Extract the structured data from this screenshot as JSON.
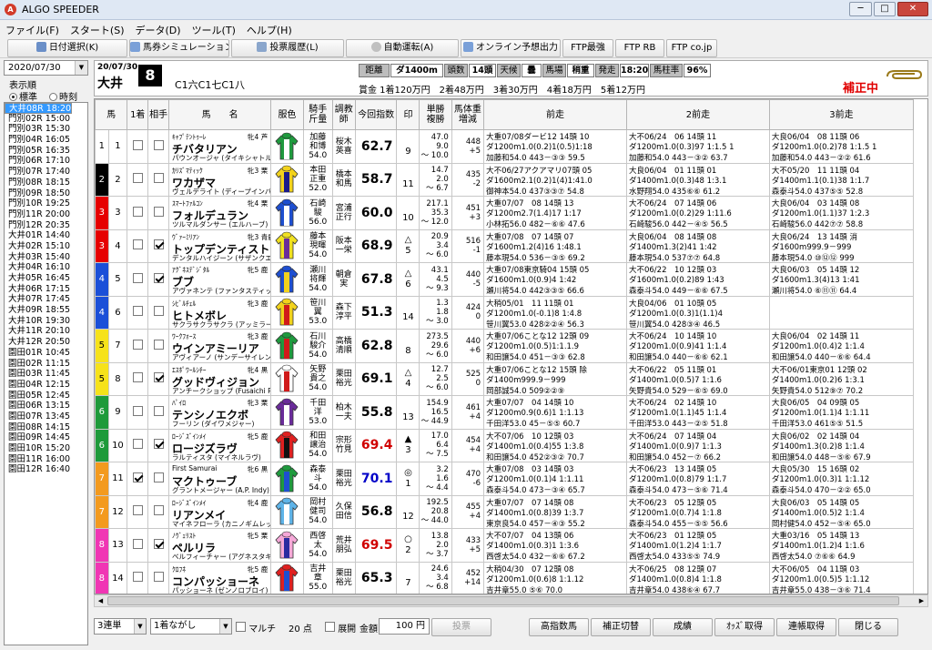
{
  "app": {
    "title": "ALGO SPEEDER",
    "min": "─",
    "max": "□",
    "close": "✕",
    "logo": "A"
  },
  "menu": [
    "ファイル(F)",
    "スタート(S)",
    "データ(D)",
    "ツール(T)",
    "ヘルプ(H)"
  ],
  "toolbar": [
    "日付選択(K)",
    "馬券シミュレーション(B)",
    "投票履歴(L)",
    "自動運転(A)",
    "オンライン予想出力",
    "FTP最強",
    "FTP RB",
    "FTP co.jp"
  ],
  "left": {
    "date": "2020/07/30",
    "group_label": "表示順",
    "radio_std": "標準",
    "radio_time": "時刻"
  },
  "races": [
    "門別01R 14:30",
    "門別02R 15:00",
    "門別03R 15:30",
    "門別04R 16:05",
    "門別05R 16:35",
    "門別06R 17:10",
    "門別07R 17:40",
    "門別08R 18:15",
    "門別09R 18:50",
    "門別10R 19:25",
    "門別11R 20:00",
    "門別12R 20:35",
    "大井01R 14:40",
    "大井02R 15:10",
    "大井03R 15:40",
    "大井04R 16:10",
    "大井05R 16:45",
    "大井06R 17:15",
    "大井07R 17:45",
    "大井08R 18:20",
    "大井09R 18:55",
    "大井10R 19:30",
    "大井11R 20:10",
    "大井12R 20:50",
    "園田01R 10:45",
    "園田02R 11:15",
    "園田03R 11:45",
    "園田04R 12:15",
    "園田05R 12:45",
    "園田06R 13:15",
    "園田07R 13:45",
    "園田08R 14:15",
    "園田09R 14:45",
    "園田10R 15:20",
    "園田11R 16:00",
    "園田12R 16:40"
  ],
  "selected_race": "大井08R 18:20",
  "race": {
    "date": "20/07/30",
    "place": "大井",
    "no": "8",
    "class": "C1六C1七C1八",
    "info": [
      [
        "距離",
        "g"
      ],
      [
        "ダ1400m",
        "w"
      ],
      [
        "頭数",
        "g"
      ],
      [
        "14頭",
        "w"
      ],
      [
        "天候",
        "g"
      ],
      [
        "曇",
        "w"
      ],
      [
        "馬場",
        "g"
      ],
      [
        "稍重",
        "w"
      ],
      [
        "発走",
        "g"
      ],
      [
        "18:20",
        "w"
      ],
      [
        "馬柱率",
        "g"
      ],
      [
        "96%",
        "w"
      ]
    ],
    "prize": "賞金 1着120万円　2着48万円　3着30万円　4着18万円　5着12万円",
    "hosei": "補正中"
  },
  "columns": [
    "馬",
    "1着",
    "相手",
    "馬　　名",
    "服色",
    "騎手\n斤量",
    "調教\n師",
    "今回指数",
    "印",
    "単勝\n複勝",
    "馬体重\n増減",
    "前走",
    "2前走",
    "3前走"
  ],
  "horses": [
    {
      "waku": "1",
      "wc": "#ffffff",
      "no": "1",
      "c1": false,
      "c2": false,
      "sire": "ｷｬﾌﾟﾃﾝﾄｩｰﾚ",
      "sex": "牝4 芦",
      "name": "チバタリアン",
      "dam": "パウンオージャ (タイキシャトル)",
      "jockey": "加藤\n和博\n54.0",
      "trainer": "桜木\n英喜",
      "idx": "62.7",
      "ic": "",
      "mark": "\n9",
      "odds": "47.0\n9.0\n～ 10.0",
      "wt": "448\n+5",
      "silk": [
        "#1f9a3e",
        "#ffffff"
      ],
      "p": [
        [
          "大重07/08ダービ12 14頭 10",
          "ダ1200m1.0(0.2)1(0.5)1:18",
          "加藤和54.0 443－③③ 59.5"
        ],
        [
          "大不06/24　06 14頭 11",
          "ダ1200m1.0(0.3)97 1:1.5 1",
          "加藤和54.0 443－③② 63.7"
        ],
        [
          "大良06/04　08 11頭 06",
          "ダ1200m1.0(0.2)78 1:1.5 1",
          "加藤和54.0 443－②② 61.6"
        ]
      ]
    },
    {
      "waku": "2",
      "wc": "#000000",
      "no": "2",
      "c1": false,
      "c2": false,
      "sire": "ｶﾘｽﾞﾏﾃｨｯｸ",
      "sex": "牝3 栗",
      "name": "ワカザマ",
      "dam": "ヴェルデライト (ディープインパクト)",
      "jockey": "本田\n正重\n52.0",
      "trainer": "橋本\n和馬",
      "idx": "58.7",
      "ic": "",
      "mark": "\n11",
      "odds": "14.7\n2.0\n～ 6.7",
      "wt": "435\n-2",
      "silk": [
        "#f2d21c",
        "#1a1a8a"
      ],
      "p": [
        [
          "大不06/27アクアマリ07頭 05",
          "ダ1600m2.1(0.2)1(4)1:41.0",
          "御神本54.0 437③③⑦ 54.8"
        ],
        [
          "大良06/04　01 11頭 01",
          "ダ1400m1.0(0.3)48 1:3.1",
          "水野翔54.0 435⑥⑥ 61.2"
        ],
        [
          "大不05/20　11 11頭 04",
          "ダ1400m1.1(0.1)38 1:1.7",
          "森泰斗54.0 437⑤⑤ 52.8"
        ]
      ]
    },
    {
      "waku": "3",
      "wc": "#e60000",
      "no": "3",
      "c1": false,
      "c2": false,
      "sire": "ｽﾏｰﾄﾌｧﾙｺﾝ",
      "sex": "牝4 栗",
      "name": "フォルデュラン",
      "dam": "ツルマルダンサー (エルハーブ)",
      "jockey": "石崎\n駿\n56.0",
      "trainer": "宮浦\n正行",
      "idx": "60.0",
      "ic": "",
      "mark": "\n10",
      "odds": "217.1\n35.3\n～ 12.0",
      "wt": "451\n+3",
      "silk": [
        "#1e4fd0",
        "#ffffff"
      ],
      "p": [
        [
          "大重07/07　08 14頭 13",
          "ダ1200m2.7(1.4)17 1:17",
          "小林拓56.0 482－⑥⑥ 47.6"
        ],
        [
          "大不06/24　07 14頭 06",
          "ダ1200m1.0(0.2)29 1:11.6",
          "石崎駿56.0 442－④⑤ 56.5"
        ],
        [
          "大良06/04　03 14頭 08",
          "ダ1200m1.0(1.1)37 1:2.3",
          "石崎駿56.0 442⑦⑦ 58.8"
        ]
      ]
    },
    {
      "waku": "3",
      "wc": "#e60000",
      "no": "4",
      "c1": false,
      "c2": true,
      "sire": "ｳﾞｧｰﾐﾘｱﾝ",
      "sex": "牝3 青鹿",
      "name": "トップデンティスト",
      "dam": "デンタルハイジーン (サザンクエスト)",
      "jockey": "藤本\n現暉\n54.0",
      "trainer": "阪本\n一栄",
      "idx": "68.9",
      "ic": "",
      "mark": "△\n5",
      "odds": "20.9\n3.4\n～ 6.0",
      "wt": "516\n-1",
      "silk": [
        "#f0e020",
        "#6a2b9a"
      ],
      "p": [
        [
          "大重07/08　07 14頭 07",
          "ダ1600m1.2(4)16 1:48.1",
          "藤本現54.0 536－③⑤ 69.2"
        ],
        [
          "大良06/04　08 14頭 08",
          "ダ1400m1.3(2)41 1:42",
          "藤本現54.0 537⑦⑦ 64.8"
        ],
        [
          "大良06/24　13 14頭 消",
          "ダ1600m999.9－999",
          "藤本現54.0 ⑩⑫⑫ 999"
        ]
      ]
    },
    {
      "waku": "4",
      "wc": "#1a4fd8",
      "no": "5",
      "c1": false,
      "c2": true,
      "sire": "ｱｸﾞﾈｽﾃﾞｼﾞﾀﾙ",
      "sex": "牝5 鹿",
      "name": "ブブ",
      "dam": "アヴァネンテ (ファンタスティックライト)",
      "jockey": "瀬川\n将輝\n54.0",
      "trainer": "朝倉\n実",
      "idx": "67.8",
      "ic": "",
      "mark": "△\n6",
      "odds": "43.1\n4.5\n～ 9.3",
      "wt": "440\n-5",
      "silk": [
        "#1e4fd0",
        "#f2d21c"
      ],
      "p": [
        [
          "大重07/08東京騎04 15頭 05",
          "ダ1600m1.0(0.9)4 1:42",
          "瀬川将54.0 442③③⑤ 66.6"
        ],
        [
          "大不06/22　10 12頭 03",
          "ダ1600m1.0(0.2)89 1:43",
          "森泰斗54.0 449－⑥⑥ 67.5"
        ],
        [
          "大良06/03　05 14頭 12",
          "ダ1600m1.3(4)13 1:41",
          "瀬川将54.0 ⑥⑪⑪ 64.4"
        ]
      ]
    },
    {
      "waku": "4",
      "wc": "#1a4fd8",
      "no": "6",
      "c1": false,
      "c2": false,
      "sire": "ｼﾋﾞﾙﾁｪﾙ",
      "sex": "牝3 鹿",
      "name": "ヒトメボレ",
      "dam": "サクラサクラサクラ (アッミラーレ)",
      "jockey": "笹川\n翼\n53.0",
      "trainer": "森下\n淳平",
      "idx": "51.3",
      "ic": "",
      "mark": "\n14",
      "odds": "1.3\n1.8\n～ 3.0",
      "wt": "424\n0",
      "silk": [
        "#f2d21c",
        "#d01a1a"
      ],
      "p": [
        [
          "大稍05/01　11 11頭 01",
          "ダ1200m1.0(-0.1)8 1:4.8",
          "笹川翼53.0 428②②④ 56.3"
        ],
        [
          "大良04/06　01 10頭 05",
          "ダ1200m1.0(0.3)1(1.1)4",
          "笹川翼54.0 428③④ 46.5"
        ],
        [
          "",
          "",
          ""
        ]
      ]
    },
    {
      "waku": "5",
      "wc": "#f6e21a",
      "no": "7",
      "c1": false,
      "c2": false,
      "sire": "ﾜｰｸﾌｫｰｽ",
      "sex": "牝3 鹿",
      "name": "ウインアミーリア",
      "dam": "アヴィアーノ (サンデーサイレンス)",
      "jockey": "石川\n駿介\n54.0",
      "trainer": "高橋\n清順",
      "idx": "62.8",
      "ic": "",
      "mark": "\n8",
      "odds": "273.5\n29.6\n～ 6.0",
      "wt": "440\n+6",
      "silk": [
        "#1f9a3e",
        "#d01a1a"
      ],
      "p": [
        [
          "大重07/06ことな12 12頭 09",
          "ダ1200m1.0(0.5)1:1.1.9",
          "和田譲54.0 451－③③ 62.8"
        ],
        [
          "大不06/24　10 14頭 10",
          "ダ1200m1.0(0.9)41 1:1.4",
          "和田譲54.0 440－⑥⑥ 62.1"
        ],
        [
          "大良06/04　02 14頭 11",
          "ダ1200m1.0(0.4)2 1:1.4",
          "和田譲54.0 440－⑥⑥ 64.4"
        ]
      ]
    },
    {
      "waku": "5",
      "wc": "#f6e21a",
      "no": "8",
      "c1": false,
      "c2": true,
      "sire": "ｴｽﾎﾟﾜｰﾙｼﾁｰ",
      "sex": "牝4 黒",
      "name": "グッドヴィジョン",
      "dam": "アンチークショップ (Fusaichi Pega",
      "jockey": "矢野\n貴之\n54.0",
      "trainer": "栗田\n裕光",
      "idx": "69.1",
      "ic": "",
      "mark": "△\n4",
      "odds": "12.7\n2.5\n～ 6.0",
      "wt": "525\n0",
      "silk": [
        "#ffffff",
        "#d01a1a"
      ],
      "p": [
        [
          "大重07/06ことな12 15頭 除",
          "ダ1400m999.9－999",
          "岡部誠54.0 509②②⑨"
        ],
        [
          "大不06/22　05 11頭 01",
          "ダ1400m1.0(0.5)7 1:1.6",
          "矢野貴54.0 529－⑥⑤ 69.0"
        ],
        [
          "大不06/01東京01 12頭 02",
          "ダ1400m1.0(0.2)6 1:3.1",
          "矢野貴54.0 512⑨⑦ 70.2"
        ]
      ]
    },
    {
      "waku": "6",
      "wc": "#1e9a3a",
      "no": "9",
      "c1": false,
      "c2": false,
      "sire": "ﾊﾟｲﾛ",
      "sex": "牝3 栗",
      "name": "テンシノエクボ",
      "dam": "フーリン (ダイワメジャー)",
      "jockey": "千田\n洋\n53.0",
      "trainer": "柏木\n一夫",
      "idx": "55.8",
      "ic": "",
      "mark": "\n13",
      "odds": "154.9\n16.5\n～ 44.9",
      "wt": "461\n+4",
      "silk": [
        "#6a2b9a",
        "#ffffff"
      ],
      "p": [
        [
          "大重07/07　04 14頭 10",
          "ダ1200m0.9(0.6)1 1:1.13",
          "千田洋53.0 45－⑤⑤ 60.7"
        ],
        [
          "大不06/24　02 14頭 10",
          "ダ1200m1.0(1.1)45 1:1.4",
          "千田洋53.0 443－②⑤ 51.8"
        ],
        [
          "大良06/05　04 09頭 05",
          "ダ1200m1.0(1.1)4 1:1.11",
          "千田洋53.0 461⑤⑤ 51.5"
        ]
      ]
    },
    {
      "waku": "6",
      "wc": "#1e9a3a",
      "no": "10",
      "c1": false,
      "c2": true,
      "sire": "ﾛｰｼﾞｽﾞｲﾝﾒｲ",
      "sex": "牝5 鹿",
      "name": "ロージズラヴ",
      "dam": "ラルティスタ (マイネルラヴ)",
      "jockey": "和田\n譲治\n54.0",
      "trainer": "宗形\n竹見",
      "idx": "69.4",
      "ic": "red",
      "mark": "▲\n3",
      "odds": "17.0\n6.4\n～ 7.5",
      "wt": "454\n+4",
      "silk": [
        "#e02020",
        "#111111"
      ],
      "p": [
        [
          "大不07/06　10 12頭 03",
          "ダ1400m1.0(0.4)55 1:3.8",
          "和田譲54.0 452②③② 70.7"
        ],
        [
          "大不06/24　07 14頭 04",
          "ダ1400m1.0(0.9)7 1:1.3",
          "和田譲54.0 452－⑦ 66.2"
        ],
        [
          "大良06/02　02 14頭 04",
          "ダ1400m1.3(0.2)8 1:1.4",
          "和田譲54.0 448－⑤⑥ 67.9"
        ]
      ]
    },
    {
      "waku": "7",
      "wc": "#f39a1e",
      "no": "11",
      "c1": true,
      "c2": false,
      "sire": "First Samurai",
      "sex": "牝6 黒",
      "name": "マクトゥーブ",
      "dam": "グラントメージャー (A.P. Indy)",
      "jockey": "森泰\n斗\n54.0",
      "trainer": "栗田\n裕光",
      "idx": "70.1",
      "ic": "blue",
      "mark": "◎\n1",
      "odds": "3.2\n1.6\n～ 4.4",
      "wt": "470\n-6",
      "silk": [
        "#1f9a3e",
        "#1e4fd0"
      ],
      "p": [
        [
          "大重07/08　03 14頭 03",
          "ダ1200m1.0(0.1)4 1:1.11",
          "森泰斗54.0 473－③④ 65.7"
        ],
        [
          "大不06/23　13 14頭 05",
          "ダ1200m1.0(0.8)79 1:1.7",
          "森泰斗54.0 473－⑤⑥ 71.4"
        ],
        [
          "大良05/30　15 16頭 02",
          "ダ1200m1.0(0.3)1 1:1.12",
          "森泰斗54.0 470－②② 65.0"
        ]
      ]
    },
    {
      "waku": "7",
      "wc": "#f39a1e",
      "no": "12",
      "c1": false,
      "c2": false,
      "sire": "ﾛｰｼﾞｽﾞｲﾝﾒｲ",
      "sex": "牝4 鹿",
      "name": "リアンメイ",
      "dam": "マイネフローラ (カニノギムレット)",
      "jockey": "岡村\n健司\n54.0",
      "trainer": "久保\n田信",
      "idx": "56.8",
      "ic": "",
      "mark": "\n12",
      "odds": "192.5\n20.8\n～ 44.0",
      "wt": "455\n+4",
      "silk": [
        "#5fb4e8",
        "#ffffff"
      ],
      "p": [
        [
          "大重07/07　07 14頭 08",
          "ダ1400m1.0(0.8)39 1:3.7",
          "東京良54.0 457－④③ 55.2"
        ],
        [
          "大不06/23　05 12頭 05",
          "ダ1200m1.0(0.7)4 1:1.8",
          "森泰斗54.0 455－⑤⑤ 56.6"
        ],
        [
          "大良06/03　05 14頭 05",
          "ダ1400m1.0(0.5)2 1:1.4",
          "岡村健54.0 452－⑤④ 65.0"
        ]
      ]
    },
    {
      "waku": "8",
      "wc": "#f036b4",
      "no": "13",
      "c1": false,
      "c2": true,
      "sire": "ﾉｳﾞｪﾘｽﾄ",
      "sex": "牝5 栗",
      "name": "ペルリラ",
      "dam": "ベルフィーチャー (アグネスタキオン)",
      "jockey": "西啓\n太\n54.0",
      "trainer": "荒井\n朋弘",
      "idx": "69.5",
      "ic": "red",
      "mark": "○\n2",
      "odds": "13.8\n2.0\n～ 3.7",
      "wt": "433\n+5",
      "silk": [
        "#f5a8d8",
        "#2a2aa0"
      ],
      "p": [
        [
          "大不07/07　04 13頭 06",
          "ダ1400m1.0(0.3)1 1:3.6",
          "西啓太54.0 432－⑥⑥ 67.2"
        ],
        [
          "大不06/23　01 12頭 05",
          "ダ1400m1.0(1.2)4 1:1.7",
          "西啓太54.0 433⑤⑤ 74.9"
        ],
        [
          "大重03/16　05 14頭 13",
          "ダ1400m1.0(1.2)4 1:1.6",
          "西啓太54.0 ⑦⑥⑥ 64.9"
        ]
      ]
    },
    {
      "waku": "8",
      "wc": "#f036b4",
      "no": "14",
      "c1": false,
      "c2": false,
      "sire": "ｸﾛﾌﾈ",
      "sex": "牝5 鹿",
      "name": "コンパッショーネ",
      "dam": "パッショーネ (ゼンノロブロイ)",
      "jockey": "吉井\n章\n55.0",
      "trainer": "栗田\n裕光",
      "idx": "65.3",
      "ic": "",
      "mark": "\n7",
      "odds": "24.6\n3.4\n～ 6.8",
      "wt": "452\n+14",
      "silk": [
        "#e02020",
        "#1e4fd0"
      ],
      "p": [
        [
          "大稍04/30　07 12頭 08",
          "ダ1200m1.0(0.6)8 1:1.12",
          "吉井章55.0 ⑤⑥ 70.0"
        ],
        [
          "大不06/25　08 12頭 07",
          "ダ1400m1.0(0.8)4 1:1.8",
          "吉井章54.0 438⑥④ 67.7"
        ],
        [
          "大不06/05　04 11頭 03",
          "ダ1200m1.0(0.5)5 1:1.12",
          "吉井章55.0 438－③⑥ 71.4"
        ]
      ]
    }
  ],
  "bottom": {
    "bet_type": "3連単",
    "bet_mode": "1着ながし",
    "multi": "マルチ",
    "points_label": "20 点",
    "tenkai": "展開",
    "amount_label": "金額:",
    "amount": "100 円",
    "vote": "投票",
    "buttons": [
      "高指数馬",
      "補正切替",
      "成績",
      "ｵｯｽﾞ取得",
      "連帳取得",
      "閉じる"
    ]
  }
}
